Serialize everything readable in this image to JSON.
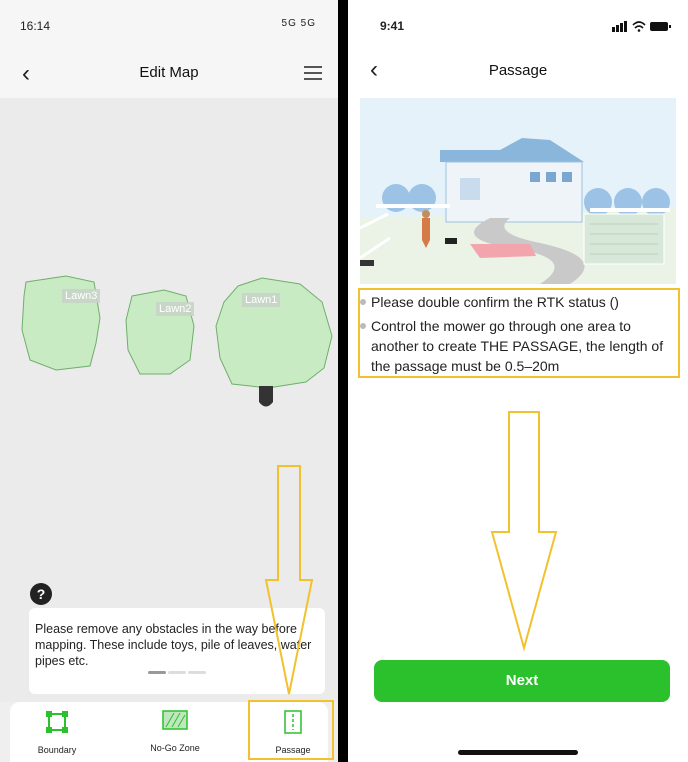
{
  "left_screen": {
    "status_time": "16:14",
    "status_signal": "5G 5G",
    "nav_title": "Edit Map",
    "lawns": [
      "Lawn3",
      "Lawn2",
      "Lawn1"
    ],
    "help_label": "?",
    "tip_text": "Please remove any obstacles in the way before mapping. These include toys, pile of leaves, water pipes etc.",
    "tools": [
      {
        "label": "Boundary",
        "icon": "boundary-icon"
      },
      {
        "label": "No-Go Zone",
        "icon": "no-go-zone-icon"
      },
      {
        "label": "Passage",
        "icon": "passage-icon"
      }
    ]
  },
  "right_screen": {
    "status_time": "9:41",
    "nav_title": "Passage",
    "bullets": [
      "Please double confirm the RTK status ()",
      "Control the mower go through one area to another to create THE PASSAGE, the length of the passage must be 0.5–20m"
    ],
    "next_label": "Next"
  },
  "colors": {
    "lawn_fill": "#c9ebc4",
    "lawn_stroke": "#6fae6a",
    "accent_green": "#2bc12c",
    "highlight_yellow": "#f2c12e"
  }
}
